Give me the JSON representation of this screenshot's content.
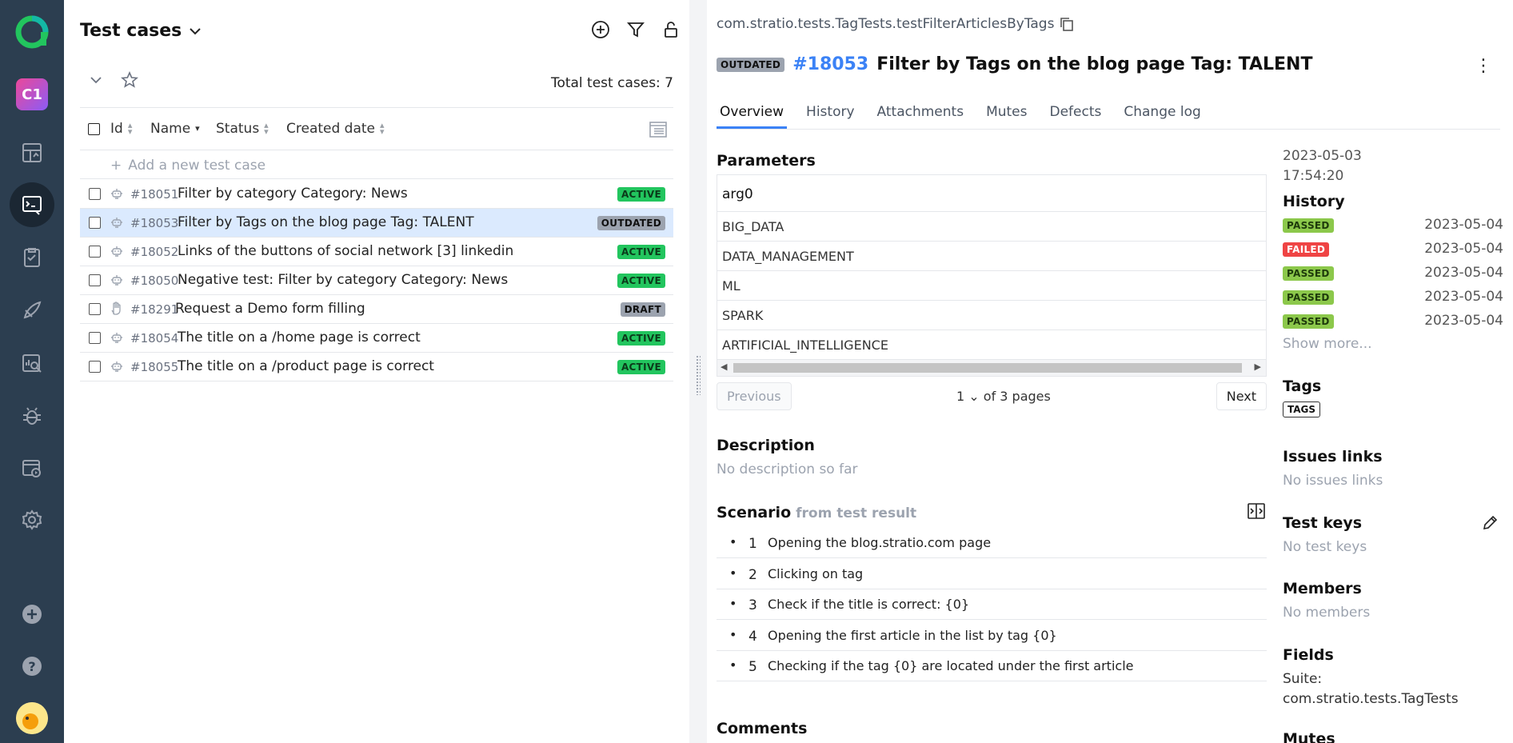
{
  "nav": {
    "project_initials": "C1",
    "items": [
      "dashboard-icon",
      "test-cases-icon",
      "test-plans-icon",
      "launches-icon",
      "analytics-icon",
      "defects-icon",
      "jobs-icon",
      "settings-icon"
    ],
    "bottom": [
      "add-icon",
      "help-icon"
    ],
    "avatar_badge": "40"
  },
  "list": {
    "title": "Test cases",
    "total_label": "Total test cases: 7",
    "columns": [
      "Id",
      "Name",
      "Status",
      "Created date"
    ],
    "add_placeholder": "Add a new test case",
    "rows": [
      {
        "id": "#18051",
        "name": "Filter by category Category: News",
        "status": "ACTIVE",
        "kind": "automated"
      },
      {
        "id": "#18053",
        "name": "Filter by Tags on the blog page Tag: TALENT",
        "status": "OUTDATED",
        "kind": "automated"
      },
      {
        "id": "#18052",
        "name": "Links of the buttons of social network [3] linkedin",
        "status": "ACTIVE",
        "kind": "automated"
      },
      {
        "id": "#18050",
        "name": "Negative test: Filter by category Category: News",
        "status": "ACTIVE",
        "kind": "automated"
      },
      {
        "id": "#18291",
        "name": "Request a Demo form filling",
        "status": "DRAFT",
        "kind": "manual"
      },
      {
        "id": "#18054",
        "name": "The title on a /home page is correct",
        "status": "ACTIVE",
        "kind": "automated"
      },
      {
        "id": "#18055",
        "name": "The title on a /product page is correct",
        "status": "ACTIVE",
        "kind": "automated"
      }
    ]
  },
  "detail": {
    "classpath": "com.stratio.tests.TagTests.testFilterArticlesByTags",
    "status_badge": "OUTDATED",
    "number": "#18053",
    "title": "Filter by Tags on the blog page Tag: TALENT",
    "tabs": [
      "Overview",
      "History",
      "Attachments",
      "Mutes",
      "Defects",
      "Change log"
    ],
    "parameters": {
      "title": "Parameters",
      "header": "arg0",
      "values": [
        "BIG_DATA",
        "DATA_MANAGEMENT",
        "ML",
        "SPARK",
        "ARTIFICIAL_INTELLIGENCE"
      ],
      "prev": "Previous",
      "next": "Next",
      "page": "1",
      "page_of": "of 3 pages"
    },
    "description": {
      "title": "Description",
      "empty": "No description so far"
    },
    "scenario": {
      "title": "Scenario",
      "source": "from test result",
      "steps": [
        {
          "n": "1",
          "text": "Opening the blog.stratio.com page"
        },
        {
          "n": "2",
          "text": "Clicking on tag"
        },
        {
          "n": "3",
          "text": "Check if the title is correct: {0}"
        },
        {
          "n": "4",
          "text": "Opening the first article in the list by tag {0}"
        },
        {
          "n": "5",
          "text": "Checking if the tag {0} are located under the first article"
        }
      ]
    },
    "comments_title": "Comments",
    "side": {
      "date": "2023-05-03",
      "time": "17:54:20",
      "history_title": "History",
      "history": [
        {
          "status": "PASSED",
          "date": "2023-05-04"
        },
        {
          "status": "FAILED",
          "date": "2023-05-04"
        },
        {
          "status": "PASSED",
          "date": "2023-05-04"
        },
        {
          "status": "PASSED",
          "date": "2023-05-04"
        },
        {
          "status": "PASSED",
          "date": "2023-05-04"
        }
      ],
      "show_more": "Show more...",
      "tags_title": "Tags",
      "tag": "TAGS",
      "issues_title": "Issues links",
      "issues_empty": "No issues links",
      "keys_title": "Test keys",
      "keys_empty": "No test keys",
      "members_title": "Members",
      "members_empty": "No members",
      "fields_title": "Fields",
      "suite_label": "Suite:",
      "suite_value": "com.stratio.tests.TagTests",
      "mutes_title": "Mutes"
    }
  }
}
